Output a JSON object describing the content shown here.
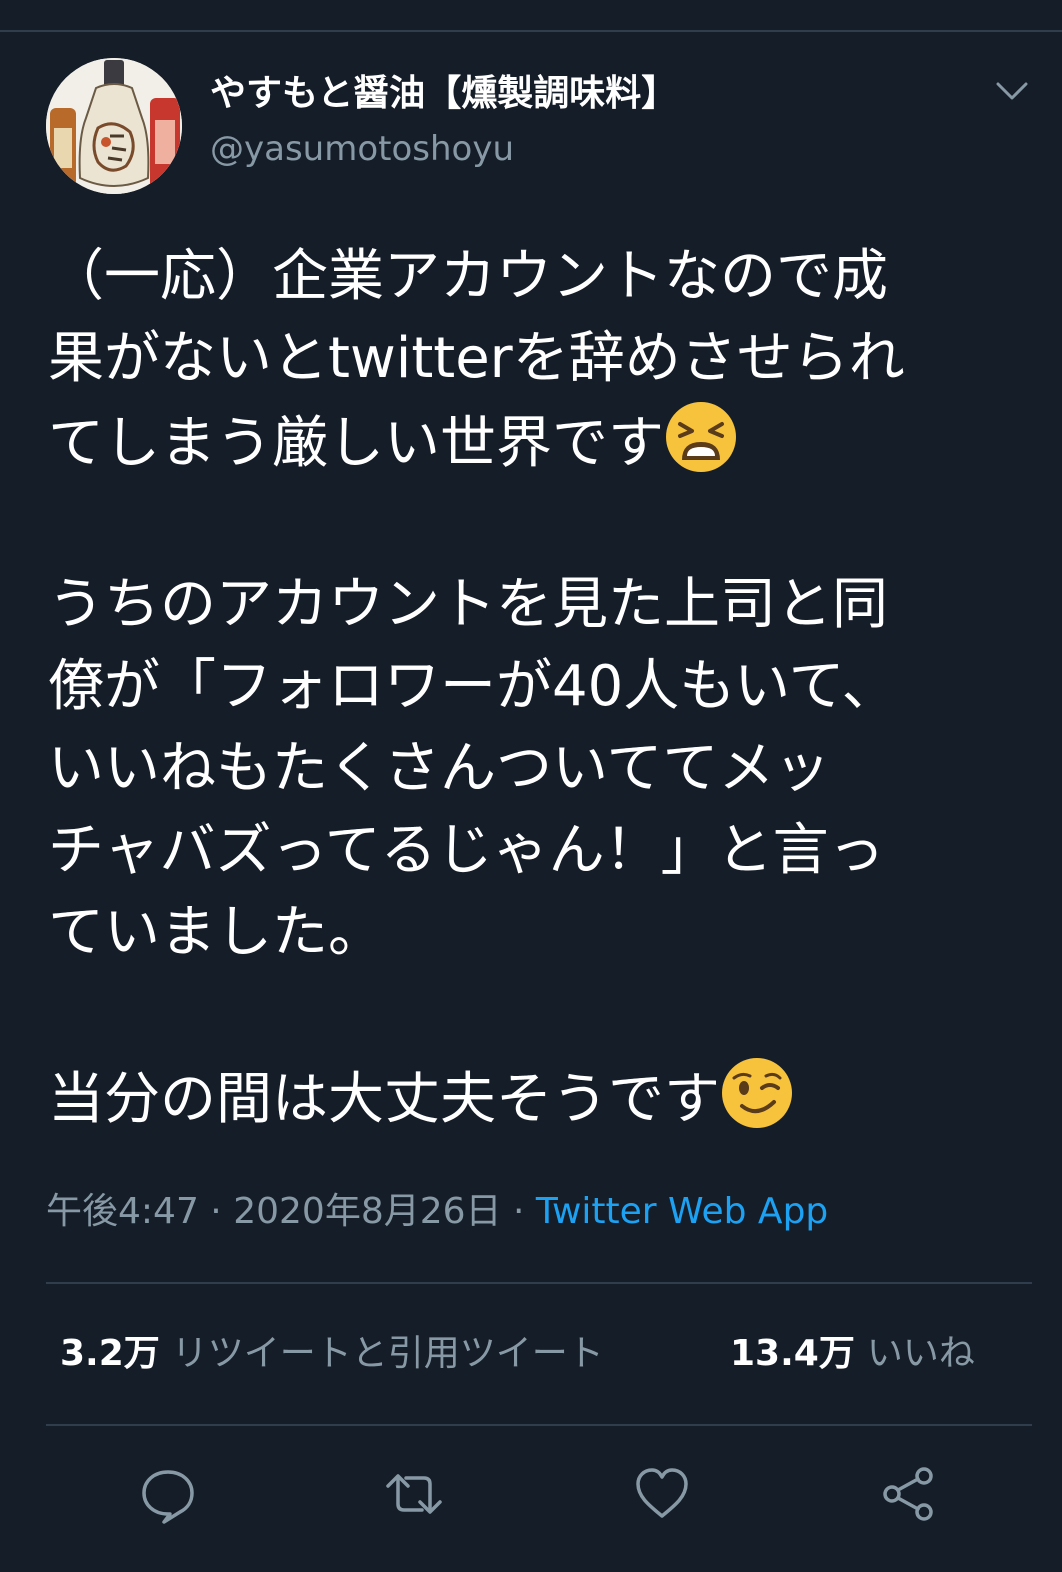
{
  "account": {
    "display_name": "やすもと醤油【燻製調味料】",
    "handle": "@yasumotoshoyu"
  },
  "tweet": {
    "lines": [
      "（一応）企業アカウントなので成",
      "果がないとtwitterを辞めさせられ",
      "てしまう厳しい世界です",
      "",
      "うちのアカウントを見た上司と同",
      "僚が「フォロワーが40人もいて、",
      "いいねもたくさんついててメッ",
      "チャバズってるじゃん！」と言っ",
      "ていました。",
      "",
      "当分の間は大丈夫そうです"
    ],
    "emoji": {
      "line3": "tired-face-emoji",
      "line11": "winking-face-emoji"
    },
    "time": "午後4:47",
    "date": "2020年8月26日",
    "separator": "·",
    "source": "Twitter Web App"
  },
  "stats": {
    "retweets_count": "3.2万",
    "retweets_label": "リツイートと引用ツイート",
    "likes_count": "13.4万",
    "likes_label": "いいね"
  },
  "actions": {
    "reply_icon": "reply-icon",
    "retweet_icon": "retweet-icon",
    "like_icon": "heart-icon",
    "share_icon": "share-icon"
  },
  "colors": {
    "background": "#151d28",
    "text": "#ffffff",
    "secondary_text": "#8899a6",
    "link": "#1da1f2",
    "divider": "#2f3d4d"
  }
}
